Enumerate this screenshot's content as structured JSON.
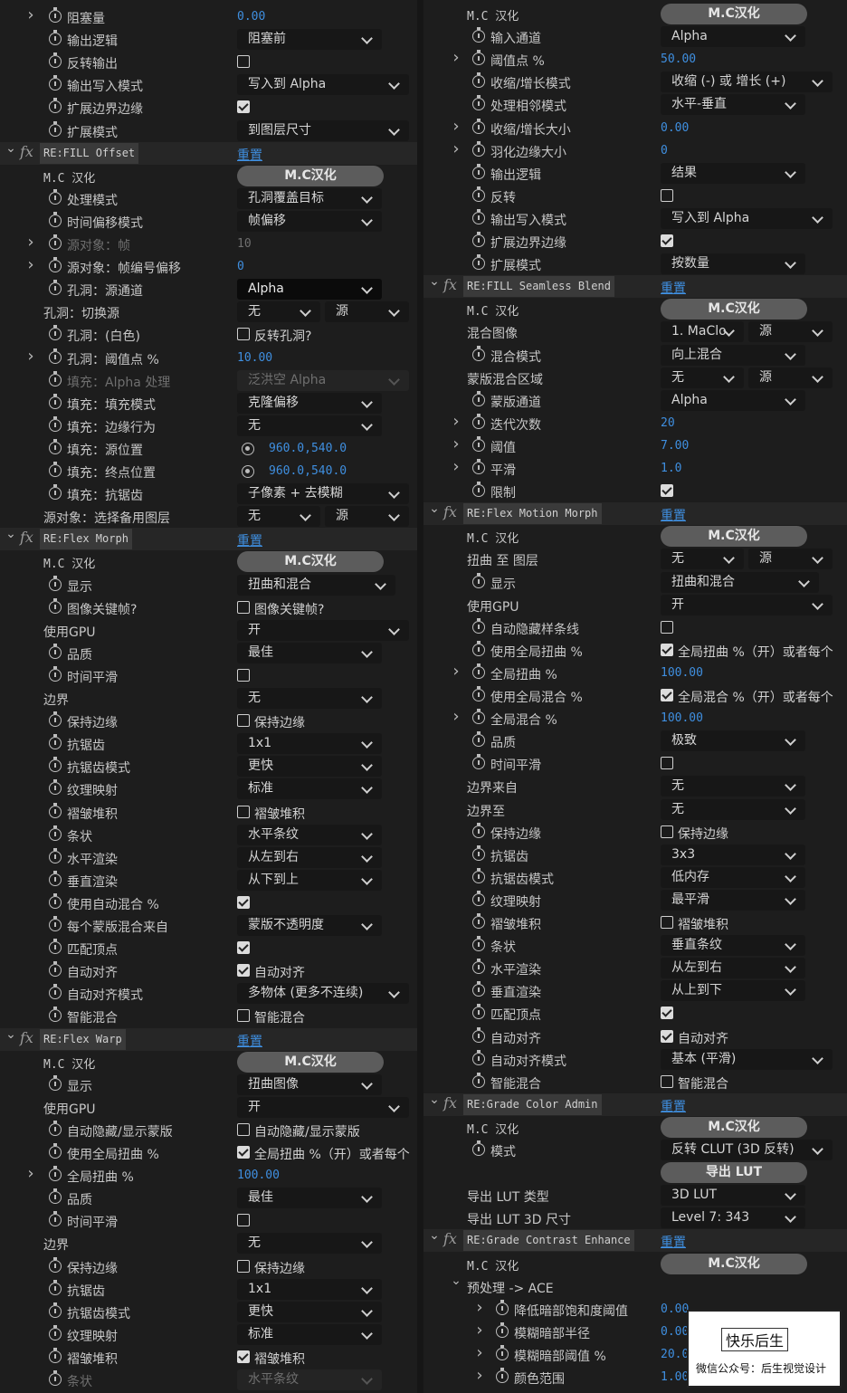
{
  "colors": {
    "accent": "#3f8fe0",
    "panel": "#1d1d1d",
    "dropdown": "#171717",
    "button": "#5c5c5c"
  },
  "left": [
    {
      "t": "dd",
      "d": 0,
      "s": 1,
      "a": 1,
      "label": "阻塞量",
      "num": "0.00"
    },
    {
      "t": "dd",
      "d": 0,
      "s": 1,
      "label": "输出逻辑",
      "dd": "阻塞前",
      "w": 160
    },
    {
      "t": "cb",
      "d": 0,
      "s": 1,
      "label": "反转输出",
      "on": false
    },
    {
      "t": "dd",
      "d": 0,
      "s": 1,
      "label": "输出写入模式",
      "dd": "写入到 Alpha",
      "w": 190
    },
    {
      "t": "cb",
      "d": 0,
      "s": 1,
      "label": "扩展边界边缘",
      "on": true
    },
    {
      "t": "dd",
      "d": 0,
      "s": 1,
      "label": "扩展模式",
      "dd": "到图层尺寸",
      "w": 190
    },
    {
      "t": "fx",
      "name": "RE:FILL Offset",
      "reset": "重置"
    },
    {
      "t": "btn",
      "d": 0,
      "label": "M.C 汉化",
      "mono": 1,
      "btn": "M.C汉化"
    },
    {
      "t": "dd",
      "d": 0,
      "s": 1,
      "label": "处理模式",
      "dd": "孔洞覆盖目标",
      "w": 160
    },
    {
      "t": "dd",
      "d": 0,
      "s": 1,
      "label": "时间偏移模式",
      "dd": "帧偏移",
      "w": 160
    },
    {
      "t": "dd",
      "d": 0,
      "s": 1,
      "a": 1,
      "dim": 1,
      "label": "源对象：帧",
      "num": "10"
    },
    {
      "t": "dd",
      "d": 0,
      "s": 1,
      "a": 1,
      "label": "源对象：帧编号偏移",
      "num": "0"
    },
    {
      "t": "dd",
      "d": 0,
      "s": 1,
      "label": "孔洞：源通道",
      "dd": "Alpha",
      "w": 160,
      "hl": 1
    },
    {
      "t": "dd2",
      "d": 0,
      "label": "孔洞：切换源",
      "dd": "无",
      "dd2": "源"
    },
    {
      "t": "cb",
      "d": 0,
      "s": 1,
      "label": "孔洞：(白色)",
      "on": false,
      "cbt": "反转孔洞?"
    },
    {
      "t": "dd",
      "d": 0,
      "s": 1,
      "a": 1,
      "label": "孔洞：阈值点 %",
      "num": "10.00"
    },
    {
      "t": "dd",
      "d": 0,
      "s": 1,
      "dim": 1,
      "label": "填充：Alpha 处理",
      "dd": "泛洪空 Alpha",
      "w": 190,
      "dis": 1
    },
    {
      "t": "dd",
      "d": 0,
      "s": 1,
      "label": "填充：填充模式",
      "dd": "克隆偏移",
      "w": 160
    },
    {
      "t": "dd",
      "d": 0,
      "s": 1,
      "label": "填充：边缘行为",
      "dd": "无",
      "w": 160
    },
    {
      "t": "pt",
      "d": 0,
      "s": 1,
      "label": "填充：源位置",
      "num": "960.0,540.0"
    },
    {
      "t": "pt",
      "d": 0,
      "s": 1,
      "label": "填充：终点位置",
      "num": "960.0,540.0"
    },
    {
      "t": "dd",
      "d": 0,
      "s": 1,
      "label": "填充：抗锯齿",
      "dd": "子像素 + 去模糊",
      "w": 190
    },
    {
      "t": "dd2",
      "d": 0,
      "label": "源对象：选择备用图层",
      "dd": "无",
      "dd2": "源"
    },
    {
      "t": "fx",
      "name": "RE:Flex Morph",
      "reset": "重置"
    },
    {
      "t": "btn",
      "d": 0,
      "label": "M.C 汉化",
      "mono": 1,
      "btn": "M.C汉化"
    },
    {
      "t": "dd",
      "d": 0,
      "s": 1,
      "label": "显示",
      "dd": "扭曲和混合",
      "w": 175
    },
    {
      "t": "cb",
      "d": 0,
      "s": 1,
      "label": "图像关键帧?",
      "on": false,
      "cbt": "图像关键帧?"
    },
    {
      "t": "dd",
      "d": 0,
      "label": "使用GPU",
      "dd": "开",
      "w": 190
    },
    {
      "t": "dd",
      "d": 0,
      "s": 1,
      "label": "品质",
      "dd": "最佳",
      "w": 160
    },
    {
      "t": "cb",
      "d": 0,
      "s": 1,
      "label": "时间平滑",
      "on": false
    },
    {
      "t": "dd",
      "d": 0,
      "label": "边界",
      "dd": "无",
      "w": 160
    },
    {
      "t": "cb",
      "d": 0,
      "s": 1,
      "label": "保持边缘",
      "on": false,
      "cbt": "保持边缘"
    },
    {
      "t": "dd",
      "d": 0,
      "s": 1,
      "label": "抗锯齿",
      "dd": "1x1",
      "w": 160
    },
    {
      "t": "dd",
      "d": 0,
      "s": 1,
      "label": "抗锯齿模式",
      "dd": "更快",
      "w": 160
    },
    {
      "t": "dd",
      "d": 0,
      "s": 1,
      "label": "纹理映射",
      "dd": "标准",
      "w": 160
    },
    {
      "t": "cb",
      "d": 0,
      "s": 1,
      "label": "褶皱堆积",
      "on": false,
      "cbt": "褶皱堆积"
    },
    {
      "t": "dd",
      "d": 0,
      "s": 1,
      "label": "条状",
      "dd": "水平条纹",
      "w": 160
    },
    {
      "t": "dd",
      "d": 0,
      "s": 1,
      "label": "水平渲染",
      "dd": "从左到右",
      "w": 160
    },
    {
      "t": "dd",
      "d": 0,
      "s": 1,
      "label": "垂直渲染",
      "dd": "从下到上",
      "w": 160
    },
    {
      "t": "cb",
      "d": 0,
      "s": 1,
      "label": "使用自动混合 %",
      "on": true
    },
    {
      "t": "dd",
      "d": 0,
      "s": 1,
      "label": "每个蒙版混合来自",
      "dd": "蒙版不透明度",
      "w": 160
    },
    {
      "t": "cb",
      "d": 0,
      "s": 1,
      "label": "匹配顶点",
      "on": true
    },
    {
      "t": "cb",
      "d": 0,
      "s": 1,
      "label": "自动对齐",
      "on": true,
      "cbt": "自动对齐"
    },
    {
      "t": "dd",
      "d": 0,
      "s": 1,
      "label": "自动对齐模式",
      "dd": "多物体 (更多不连续)",
      "w": 190
    },
    {
      "t": "cb",
      "d": 0,
      "s": 1,
      "label": "智能混合",
      "on": false,
      "cbt": "智能混合"
    },
    {
      "t": "fx",
      "name": "RE:Flex Warp",
      "reset": "重置"
    },
    {
      "t": "btn",
      "d": 0,
      "label": "M.C 汉化",
      "mono": 1,
      "btn": "M.C汉化"
    },
    {
      "t": "dd",
      "d": 0,
      "s": 1,
      "label": "显示",
      "dd": "扭曲图像",
      "w": 160
    },
    {
      "t": "dd",
      "d": 0,
      "label": "使用GPU",
      "dd": "开",
      "w": 190
    },
    {
      "t": "cb",
      "d": 0,
      "s": 1,
      "label": "自动隐藏/显示蒙版",
      "on": false,
      "cbt": "自动隐藏/显示蒙版"
    },
    {
      "t": "cb",
      "d": 0,
      "s": 1,
      "label": "使用全局扭曲 %",
      "on": true,
      "cbt": "全局扭曲 %（开）或者每个"
    },
    {
      "t": "dd",
      "d": 0,
      "s": 1,
      "a": 1,
      "label": "全局扭曲 %",
      "num": "100.00"
    },
    {
      "t": "dd",
      "d": 0,
      "s": 1,
      "label": "品质",
      "dd": "最佳",
      "w": 160
    },
    {
      "t": "cb",
      "d": 0,
      "s": 1,
      "label": "时间平滑",
      "on": false
    },
    {
      "t": "dd",
      "d": 0,
      "label": "边界",
      "dd": "无",
      "w": 160
    },
    {
      "t": "cb",
      "d": 0,
      "s": 1,
      "label": "保持边缘",
      "on": false,
      "cbt": "保持边缘"
    },
    {
      "t": "dd",
      "d": 0,
      "s": 1,
      "label": "抗锯齿",
      "dd": "1x1",
      "w": 160
    },
    {
      "t": "dd",
      "d": 0,
      "s": 1,
      "label": "抗锯齿模式",
      "dd": "更快",
      "w": 160
    },
    {
      "t": "dd",
      "d": 0,
      "s": 1,
      "label": "纹理映射",
      "dd": "标准",
      "w": 160
    },
    {
      "t": "cb",
      "d": 0,
      "s": 1,
      "label": "褶皱堆积",
      "on": true,
      "cbt": "褶皱堆积"
    },
    {
      "t": "dd",
      "d": 0,
      "s": 1,
      "dim": 1,
      "label": "条状",
      "dd": "水平条纹",
      "w": 160,
      "dis": 1
    }
  ],
  "right": [
    {
      "t": "btn",
      "d": 0,
      "label": "M.C 汉化",
      "mono": 1,
      "btn": "M.C汉化"
    },
    {
      "t": "dd",
      "d": 0,
      "s": 1,
      "label": "输入通道",
      "dd": "Alpha",
      "w": 160
    },
    {
      "t": "dd",
      "d": 0,
      "s": 1,
      "a": 1,
      "label": "阈值点 %",
      "num": "50.00"
    },
    {
      "t": "dd",
      "d": 0,
      "s": 1,
      "label": "收缩/增长模式",
      "dd": "收缩 (-) 或 增长 (+)",
      "w": 190
    },
    {
      "t": "dd",
      "d": 0,
      "s": 1,
      "label": "处理相邻模式",
      "dd": "水平-垂直",
      "w": 160
    },
    {
      "t": "dd",
      "d": 0,
      "s": 1,
      "a": 1,
      "label": "收缩/增长大小",
      "num": "0.00"
    },
    {
      "t": "dd",
      "d": 0,
      "s": 1,
      "a": 1,
      "label": "羽化边缘大小",
      "num": "0"
    },
    {
      "t": "dd",
      "d": 0,
      "s": 1,
      "label": "输出逻辑",
      "dd": "结果",
      "w": 160
    },
    {
      "t": "cb",
      "d": 0,
      "s": 1,
      "label": "反转",
      "on": false
    },
    {
      "t": "dd",
      "d": 0,
      "s": 1,
      "label": "输出写入模式",
      "dd": "写入到 Alpha",
      "w": 190
    },
    {
      "t": "cb",
      "d": 0,
      "s": 1,
      "label": "扩展边界边缘",
      "on": true
    },
    {
      "t": "dd",
      "d": 0,
      "s": 1,
      "label": "扩展模式",
      "dd": "按数量",
      "w": 160
    },
    {
      "t": "fx",
      "name": "RE:FILL Seamless Blend",
      "reset": "重置"
    },
    {
      "t": "btn",
      "d": 0,
      "label": "M.C 汉化",
      "mono": 1,
      "btn": "M.C汉化"
    },
    {
      "t": "dd2",
      "d": 0,
      "label": "混合图像",
      "dd": "1. MaClo",
      "dd2": "源"
    },
    {
      "t": "dd",
      "d": 0,
      "s": 1,
      "label": "混合模式",
      "dd": "向上混合",
      "w": 160
    },
    {
      "t": "dd2",
      "d": 0,
      "label": "蒙版混合区域",
      "dd": "无",
      "dd2": "源"
    },
    {
      "t": "dd",
      "d": 0,
      "s": 1,
      "label": "蒙版通道",
      "dd": "Alpha",
      "w": 160
    },
    {
      "t": "dd",
      "d": 0,
      "s": 1,
      "a": 1,
      "label": "迭代次数",
      "num": "20"
    },
    {
      "t": "dd",
      "d": 0,
      "s": 1,
      "a": 1,
      "label": "阈值",
      "num": "7.00"
    },
    {
      "t": "dd",
      "d": 0,
      "s": 1,
      "a": 1,
      "label": "平滑",
      "num": "1.0"
    },
    {
      "t": "cb",
      "d": 0,
      "s": 1,
      "label": "限制",
      "on": true
    },
    {
      "t": "fx",
      "name": "RE:Flex Motion Morph",
      "reset": "重置"
    },
    {
      "t": "btn",
      "d": 0,
      "label": "M.C 汉化",
      "mono": 1,
      "btn": "M.C汉化"
    },
    {
      "t": "dd2",
      "d": 0,
      "label": "扭曲 至 图层",
      "dd": "无",
      "dd2": "源"
    },
    {
      "t": "dd",
      "d": 0,
      "s": 1,
      "label": "显示",
      "dd": "扭曲和混合",
      "w": 175
    },
    {
      "t": "dd",
      "d": 0,
      "label": "使用GPU",
      "dd": "开",
      "w": 190
    },
    {
      "t": "cb",
      "d": 0,
      "s": 1,
      "label": "自动隐藏样条线",
      "on": false
    },
    {
      "t": "cb",
      "d": 0,
      "s": 1,
      "label": "使用全局扭曲 %",
      "on": true,
      "cbt": "全局扭曲 %（开）或者每个"
    },
    {
      "t": "dd",
      "d": 0,
      "s": 1,
      "a": 1,
      "label": "全局扭曲 %",
      "num": "100.00"
    },
    {
      "t": "cb",
      "d": 0,
      "s": 1,
      "label": "使用全局混合 %",
      "on": true,
      "cbt": "全局混合 %（开）或者每个"
    },
    {
      "t": "dd",
      "d": 0,
      "s": 1,
      "a": 1,
      "label": "全局混合 %",
      "num": "100.00"
    },
    {
      "t": "dd",
      "d": 0,
      "s": 1,
      "label": "品质",
      "dd": "极致",
      "w": 160
    },
    {
      "t": "cb",
      "d": 0,
      "s": 1,
      "label": "时间平滑",
      "on": false
    },
    {
      "t": "dd",
      "d": 0,
      "label": "边界来自",
      "dd": "无",
      "w": 160
    },
    {
      "t": "dd",
      "d": 0,
      "label": "边界至",
      "dd": "无",
      "w": 160
    },
    {
      "t": "cb",
      "d": 0,
      "s": 1,
      "label": "保持边缘",
      "on": false,
      "cbt": "保持边缘"
    },
    {
      "t": "dd",
      "d": 0,
      "s": 1,
      "label": "抗锯齿",
      "dd": "3x3",
      "w": 160
    },
    {
      "t": "dd",
      "d": 0,
      "s": 1,
      "label": "抗锯齿模式",
      "dd": "低内存",
      "w": 160
    },
    {
      "t": "dd",
      "d": 0,
      "s": 1,
      "label": "纹理映射",
      "dd": "最平滑",
      "w": 160
    },
    {
      "t": "cb",
      "d": 0,
      "s": 1,
      "label": "褶皱堆积",
      "on": false,
      "cbt": "褶皱堆积"
    },
    {
      "t": "dd",
      "d": 0,
      "s": 1,
      "label": "条状",
      "dd": "垂直条纹",
      "w": 160
    },
    {
      "t": "dd",
      "d": 0,
      "s": 1,
      "label": "水平渲染",
      "dd": "从左到右",
      "w": 160
    },
    {
      "t": "dd",
      "d": 0,
      "s": 1,
      "label": "垂直渲染",
      "dd": "从上到下",
      "w": 160
    },
    {
      "t": "cb",
      "d": 0,
      "s": 1,
      "label": "匹配顶点",
      "on": true
    },
    {
      "t": "cb",
      "d": 0,
      "s": 1,
      "label": "自动对齐",
      "on": true,
      "cbt": "自动对齐"
    },
    {
      "t": "dd",
      "d": 0,
      "s": 1,
      "label": "自动对齐模式",
      "dd": "基本 (平滑)",
      "w": 190
    },
    {
      "t": "cb",
      "d": 0,
      "s": 1,
      "label": "智能混合",
      "on": false,
      "cbt": "智能混合"
    },
    {
      "t": "fx",
      "name": "RE:Grade Color Admin",
      "reset": "重置"
    },
    {
      "t": "btn",
      "d": 0,
      "label": "M.C 汉化",
      "mono": 1,
      "btn": "M.C汉化"
    },
    {
      "t": "dd",
      "d": 0,
      "s": 1,
      "label": "模式",
      "dd": "反转 CLUT (3D 反转)",
      "w": 190
    },
    {
      "t": "btn",
      "d": 0,
      "label": "",
      "btn": "导出 LUT"
    },
    {
      "t": "dd",
      "d": 0,
      "label": "导出 LUT 类型",
      "dd": "3D LUT",
      "w": 160
    },
    {
      "t": "dd",
      "d": 0,
      "label": "导出 LUT 3D 尺寸",
      "dd": "Level 7: 343",
      "w": 160
    },
    {
      "t": "fx",
      "name": "RE:Grade Contrast Enhance",
      "reset": "重置"
    },
    {
      "t": "btn",
      "d": 0,
      "label": "M.C 汉化",
      "mono": 1,
      "btn": "M.C汉化"
    },
    {
      "t": "grp",
      "d": 0,
      "label": "预处理 -> ACE"
    },
    {
      "t": "dd",
      "d": 1,
      "s": 1,
      "a": 1,
      "label": "降低暗部饱和度阈值",
      "num": "0.00"
    },
    {
      "t": "dd",
      "d": 1,
      "s": 1,
      "a": 1,
      "label": "模糊暗部半径",
      "num": "0.00"
    },
    {
      "t": "dd",
      "d": 1,
      "s": 1,
      "a": 1,
      "label": "模糊暗部阈值 %",
      "num": "20.00"
    },
    {
      "t": "dd",
      "d": 1,
      "s": 1,
      "a": 1,
      "label": "颜色范围",
      "num": "1.00"
    }
  ],
  "watermark": {
    "line1": "快乐后生",
    "line2": "微信公众号：后生视觉设计"
  }
}
